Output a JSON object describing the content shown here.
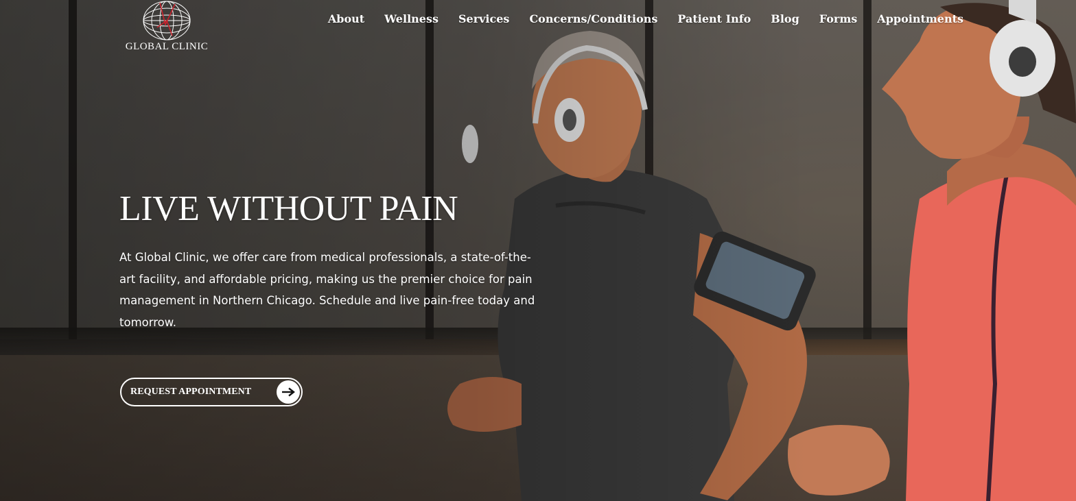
{
  "brand": {
    "name": "GLOBAL CLINIC",
    "logo_icon": "wireframe-globe-logo",
    "accent_color": "#c8222c"
  },
  "nav": {
    "items": [
      {
        "label": "About"
      },
      {
        "label": "Wellness"
      },
      {
        "label": "Services"
      },
      {
        "label": "Concerns/Conditions"
      },
      {
        "label": "Patient Info"
      },
      {
        "label": "Blog"
      },
      {
        "label": "Forms"
      },
      {
        "label": "Appointments"
      }
    ]
  },
  "hero": {
    "headline": "LIVE WITHOUT PAIN",
    "intro": "At Global Clinic, we offer care from medical professionals, a state-of-the-art facility, and affordable pricing, making us the premier choice for pain management in Northern Chicago. Schedule and live pain-free today and tomorrow.",
    "cta_label": "REQUEST APPOINTMENT",
    "cta_icon": "arrow-right-icon",
    "image": "two-runners-with-headphones-photo"
  }
}
